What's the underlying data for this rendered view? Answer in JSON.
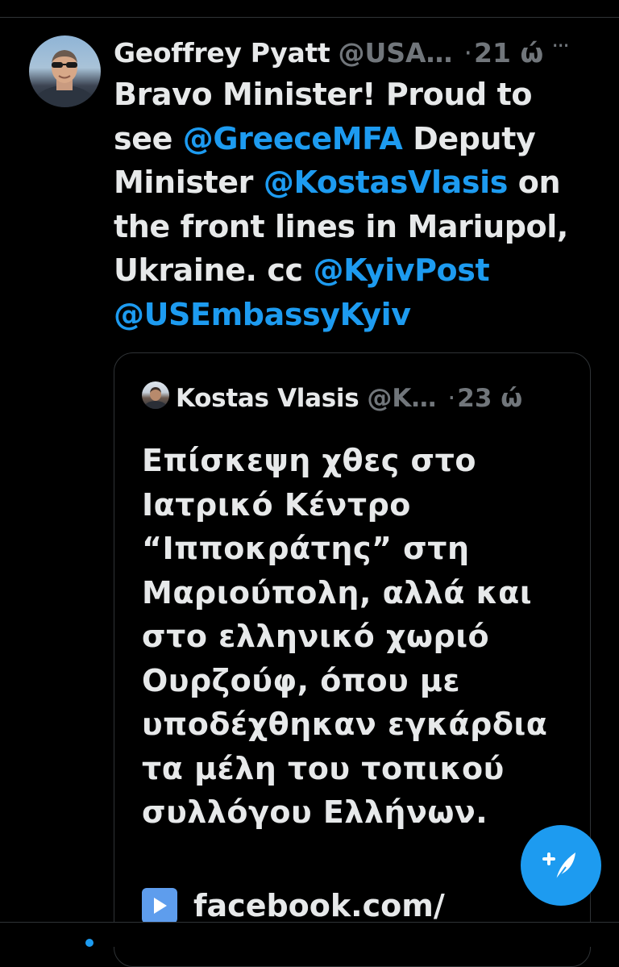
{
  "tweet": {
    "author_name": "Geoffrey Pyatt",
    "author_handle": "@USA…",
    "separator": "·",
    "time": "21 ώ",
    "more_label": "···",
    "text_line1": "Bravo Minister!  Proud to",
    "text_see": "see ",
    "mention1": "@GreeceMFA",
    "text_deputy": " Deputy",
    "text_minister": "Minister ",
    "mention2": "@KostasVlasis",
    "text_on": " on",
    "text_line4": "the front lines in Mariupol,",
    "text_ukraine": "Ukraine. cc ",
    "mention3": "@KyivPost",
    "mention4": "@USEmbassyKyiv"
  },
  "quoted_tweet": {
    "author_name": "Kostas Vlasis",
    "author_handle": "@K…",
    "separator": "·",
    "time": "23 ώ",
    "lines": [
      "Επίσκεψη χθες στο",
      "Ιατρικό Κέντρο",
      "“Ιπποκράτης” στη",
      "Μαριούπολη, αλλά και",
      "στο ελληνικό χωριό",
      "Ουρζούφ, όπου με",
      "υποδέχθηκαν εγκάρδια",
      "τα μέλη του τοπικού",
      "συλλόγου Ελλήνων."
    ],
    "link_text": "facebook.com/"
  },
  "colors": {
    "background": "#000000",
    "text": "#e7e9ea",
    "secondary": "#71767b",
    "accent": "#1d9bf0",
    "border": "#2f3336"
  },
  "icons": {
    "more": "more-horizontal-icon",
    "play": "play-button-icon",
    "compose": "compose-tweet-icon"
  }
}
